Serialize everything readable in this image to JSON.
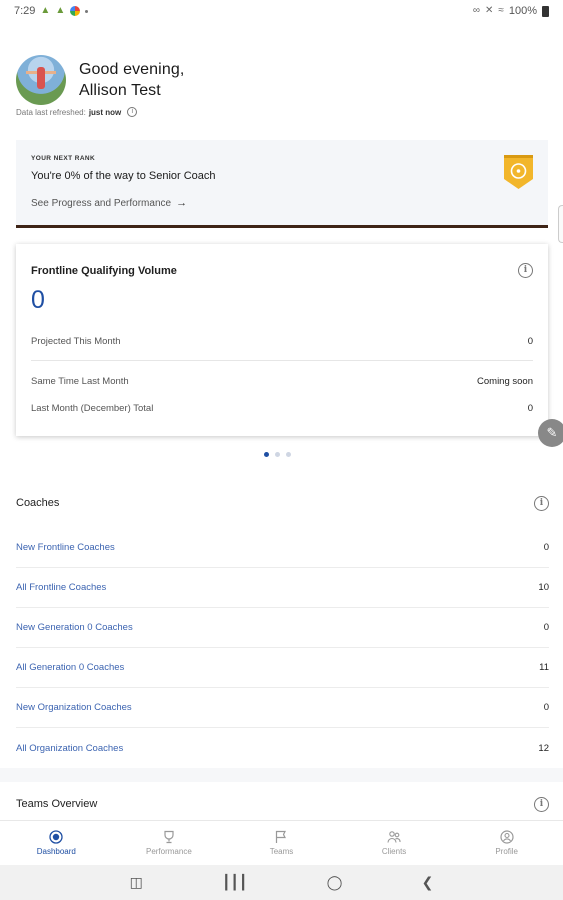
{
  "status_bar": {
    "time": "7:29",
    "battery": "100%"
  },
  "header": {
    "greeting_line1": "Good evening,",
    "greeting_line2": "Allison Test",
    "refresh_label": "Data last refreshed:",
    "refresh_value": "just now"
  },
  "rank_card": {
    "eyebrow": "YOUR NEXT RANK",
    "title": "You're 0% of the way to Senior Coach",
    "link": "See Progress and Performance",
    "accent_color": "#3e2417",
    "badge_color": "#f2b62b"
  },
  "volume_card": {
    "title": "Frontline Qualifying Volume",
    "value": "0",
    "rows": [
      {
        "label": "Projected This Month",
        "value": "0"
      },
      {
        "label": "Same Time Last Month",
        "value": "Coming soon"
      },
      {
        "label": "Last Month (December) Total",
        "value": "0"
      }
    ]
  },
  "carousel": {
    "page_count": 3,
    "active_index": 0
  },
  "coaches": {
    "title": "Coaches",
    "rows": [
      {
        "label": "New Frontline Coaches",
        "value": "0"
      },
      {
        "label": "All Frontline Coaches",
        "value": "10"
      },
      {
        "label": "New Generation 0 Coaches",
        "value": "0"
      },
      {
        "label": "All Generation 0 Coaches",
        "value": "11"
      },
      {
        "label": "New Organization Coaches",
        "value": "0"
      },
      {
        "label": "All Organization Coaches",
        "value": "12"
      }
    ]
  },
  "teams_overview": {
    "title": "Teams Overview"
  },
  "bottom_nav": {
    "items": [
      {
        "label": "Dashboard",
        "icon": "dashboard-icon"
      },
      {
        "label": "Performance",
        "icon": "trophy-icon"
      },
      {
        "label": "Teams",
        "icon": "flag-icon"
      },
      {
        "label": "Clients",
        "icon": "people-icon"
      },
      {
        "label": "Profile",
        "icon": "person-icon"
      }
    ],
    "active": "Dashboard",
    "active_color": "#1f4fa3"
  }
}
